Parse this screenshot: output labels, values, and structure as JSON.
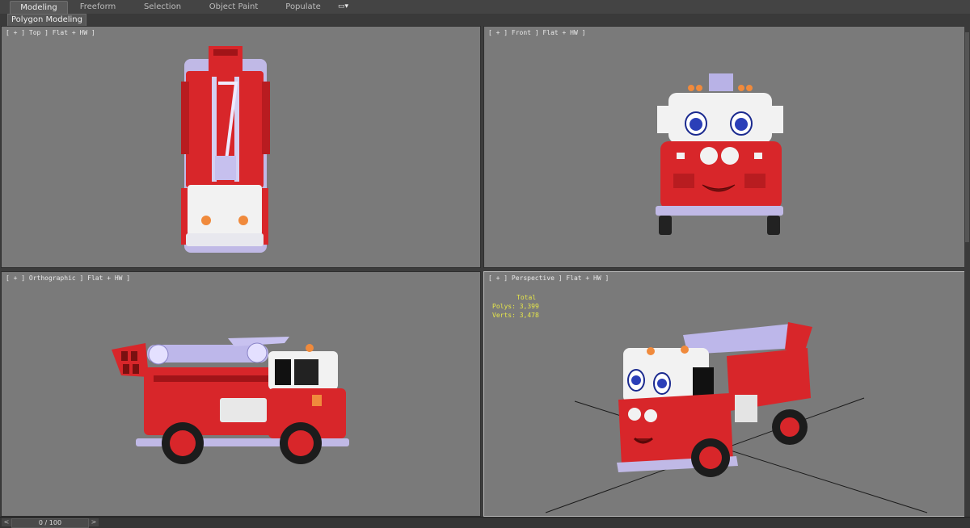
{
  "ribbon": {
    "tabs": [
      {
        "label": "Modeling",
        "active": true
      },
      {
        "label": "Freeform",
        "active": false
      },
      {
        "label": "Selection",
        "active": false
      },
      {
        "label": "Object Paint",
        "active": false
      },
      {
        "label": "Populate",
        "active": false
      }
    ],
    "options_icon": "dropdown-options-icon"
  },
  "subtab": {
    "label": "Polygon Modeling"
  },
  "viewports": {
    "top": {
      "label": "[ + ] Top ] Flat + HW ]"
    },
    "front": {
      "label": "[ + ] Front ] Flat + HW ]"
    },
    "ortho": {
      "label": "[ + ] Orthographic ] Flat + HW ]"
    },
    "persp": {
      "label": "[ + ] Perspective ] Flat + HW ]"
    }
  },
  "stats": {
    "header": "Total",
    "polys_label": "Polys:",
    "polys_value": "3,399",
    "verts_label": "Verts:",
    "verts_value": "3,478"
  },
  "timeline": {
    "frame": "0 / 100",
    "prev": "<",
    "next": ">"
  },
  "colors": {
    "viewport_bg": "#7a7a7a",
    "truck_red": "#d8262a",
    "truck_white": "#f2f2f2",
    "ladder": "#b9b3e6",
    "stats_yellow": "#e6e64a"
  }
}
